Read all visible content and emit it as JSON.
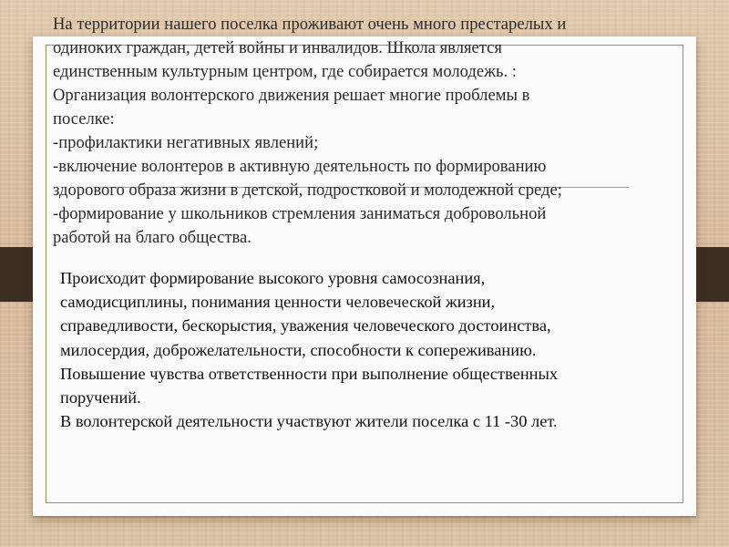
{
  "top_paragraph": {
    "lines": [
      "На территории нашего поселка проживают очень много престарелых и",
      "одиноких граждан, детей войны и инвалидов. Школа является",
      "единственным культурным центром, где собирается молодежь. :",
      "Организация волонтерского движения  решает многие проблемы в",
      "поселке:",
      "-профилактики негативных явлений;",
      "-включение волонтеров в активную деятельность по формированию",
      "здорового образа жизни в детской, подростковой и молодежной среде;",
      "-формирование у школьников стремления заниматься добровольной",
      "работой на благо общества."
    ]
  },
  "bottom_paragraph": {
    "lines": [
      "Происходит формирование  высокого уровня самосознания,",
      "самодисциплины, понимания ценности человеческой жизни,",
      "справедливости, бескорыстия, уважения человеческого достоинства,",
      "милосердия, доброжелательности, способности к сопереживанию.",
      "Повышение чувства ответственности при выполнение общественных",
      "поручений.",
      "В волонтерской деятельности участвуют жители поселка с 11 -30 лет."
    ]
  },
  "colors": {
    "background": "#d9bfa0",
    "card": "#fbfbfb",
    "frame": "#8f9a4a",
    "tabs": "#3d2e24"
  }
}
